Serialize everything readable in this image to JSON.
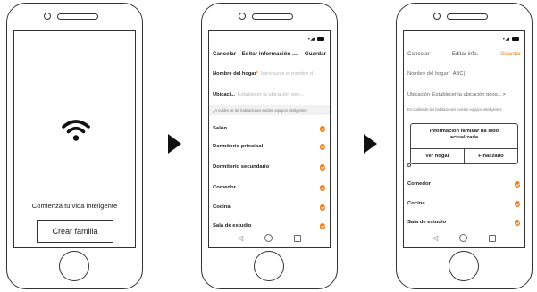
{
  "phone1": {
    "tagline": "Comienza tu vida inteligente",
    "create_button": "Crear familia"
  },
  "phone2": {
    "header": {
      "cancel": "Cancelar",
      "title": "Editar información d...",
      "save": "Guardar"
    },
    "home_name": {
      "label": "Nombre del hogar",
      "required": "*",
      "placeholder": "Introduzca el nombre d..."
    },
    "location": {
      "label": "Ubicaci...",
      "placeholder": "Establecer la ubicación geo..."
    },
    "hint": "¿A cuáles de las habitaciones existen equipos inteligentes",
    "rooms": [
      "Salón",
      "Dormitorio principal",
      "Dormitorio secundario",
      "Comedor",
      "Cocina",
      "Sala de estudio"
    ]
  },
  "phone3": {
    "header": {
      "cancel": "Cancelar",
      "title": "Editar info.",
      "save": "Guardar"
    },
    "home_name": {
      "label": "Nombre del hogar",
      "required": "*",
      "value": "ABC|"
    },
    "location": {
      "label": "Ubicación",
      "value": "Establecer la ubicación geog...",
      "chevron": ">"
    },
    "hint": "En cuáles de las habitaciones existen equipos inteligentes",
    "dialog": {
      "message": "Información familiar ha sido actualizada",
      "view_button": "Ver hogar",
      "finish_button": "Finalizado"
    },
    "rooms": [
      "D",
      "Comedor",
      "Cocina",
      "Sala de estudio"
    ]
  },
  "colors": {
    "accent": "#ef7d1a"
  },
  "icons": {
    "wifi": "wifi-icon",
    "check": "check-icon",
    "back": "nav-back-icon",
    "home": "nav-home-icon",
    "recents": "nav-recents-icon",
    "next": "arrow-right-icon",
    "signal": "signal-icon",
    "battery": "battery-icon"
  }
}
